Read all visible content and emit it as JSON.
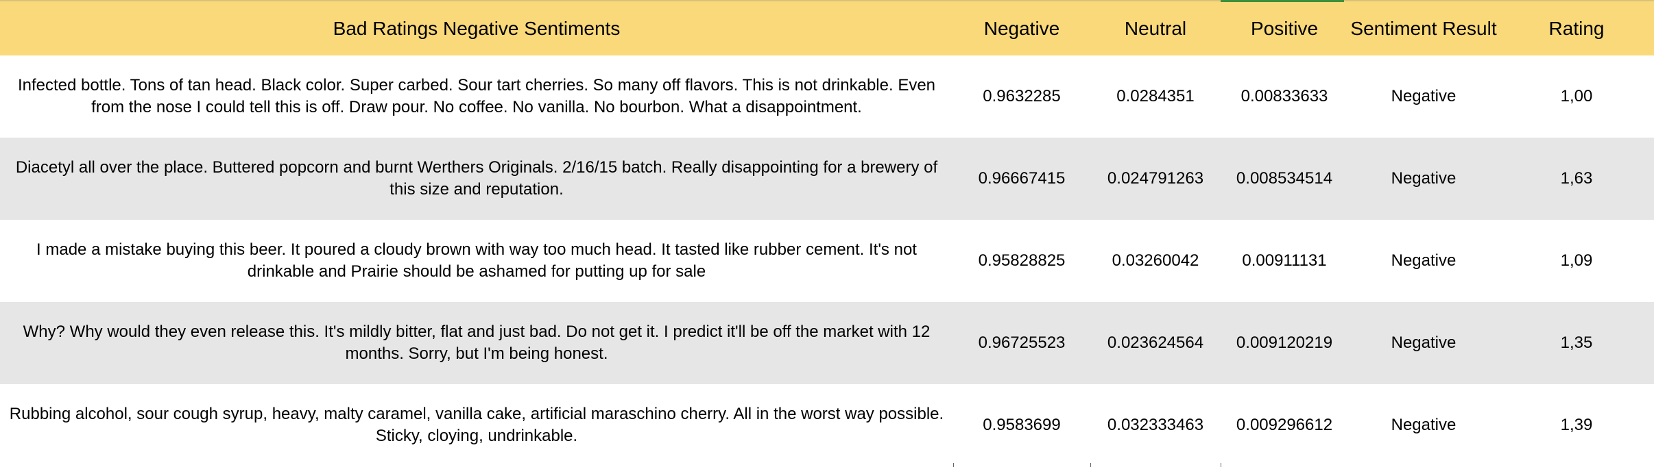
{
  "headers": {
    "review": "Bad Ratings Negative Sentiments",
    "negative": "Negative",
    "neutral": "Neutral",
    "positive": "Positive",
    "result": "Sentiment Result",
    "rating": "Rating"
  },
  "rows": [
    {
      "review": "Infected bottle. Tons of tan head. Black color. Super carbed. Sour tart cherries. So many off flavors. This is not drinkable. Even from the nose I could tell this is off. Draw pour. No coffee. No vanilla. No bourbon. What a disappointment.",
      "negative": "0.9632285",
      "neutral": "0.0284351",
      "positive": "0.00833633",
      "result": "Negative",
      "rating": "1,00"
    },
    {
      "review": "Diacetyl all over the place. Buttered popcorn and burnt Werthers Originals. 2/16/15 batch. Really disappointing for a brewery of this size and reputation.",
      "negative": "0.96667415",
      "neutral": "0.024791263",
      "positive": "0.008534514",
      "result": "Negative",
      "rating": "1,63"
    },
    {
      "review": "I made a mistake buying this beer. It poured a cloudy brown with way too much head. It tasted like rubber cement. It's not drinkable and Prairie should be ashamed for putting up for sale",
      "negative": "0.95828825",
      "neutral": "0.03260042",
      "positive": "0.00911131",
      "result": "Negative",
      "rating": "1,09"
    },
    {
      "review": "Why? Why would they even release this. It's mildly bitter, flat and just bad. Do not get it. I predict it'll be off the market with 12 months. Sorry, but I'm being honest.",
      "negative": "0.96725523",
      "neutral": "0.023624564",
      "positive": "0.009120219",
      "result": "Negative",
      "rating": "1,35"
    },
    {
      "review": "Rubbing alcohol, sour cough syrup, heavy, malty caramel, vanilla cake, artificial maraschino cherry. All in the worst way possible. Sticky, cloying, undrinkable.",
      "negative": "0.9583699",
      "neutral": "0.032333463",
      "positive": "0.009296612",
      "result": "Negative",
      "rating": "1,39"
    }
  ],
  "colors": {
    "header_background": "#fad97a",
    "alt_row_background": "#e6e6e6",
    "selected_cell_accent": "#3d8f3d"
  }
}
